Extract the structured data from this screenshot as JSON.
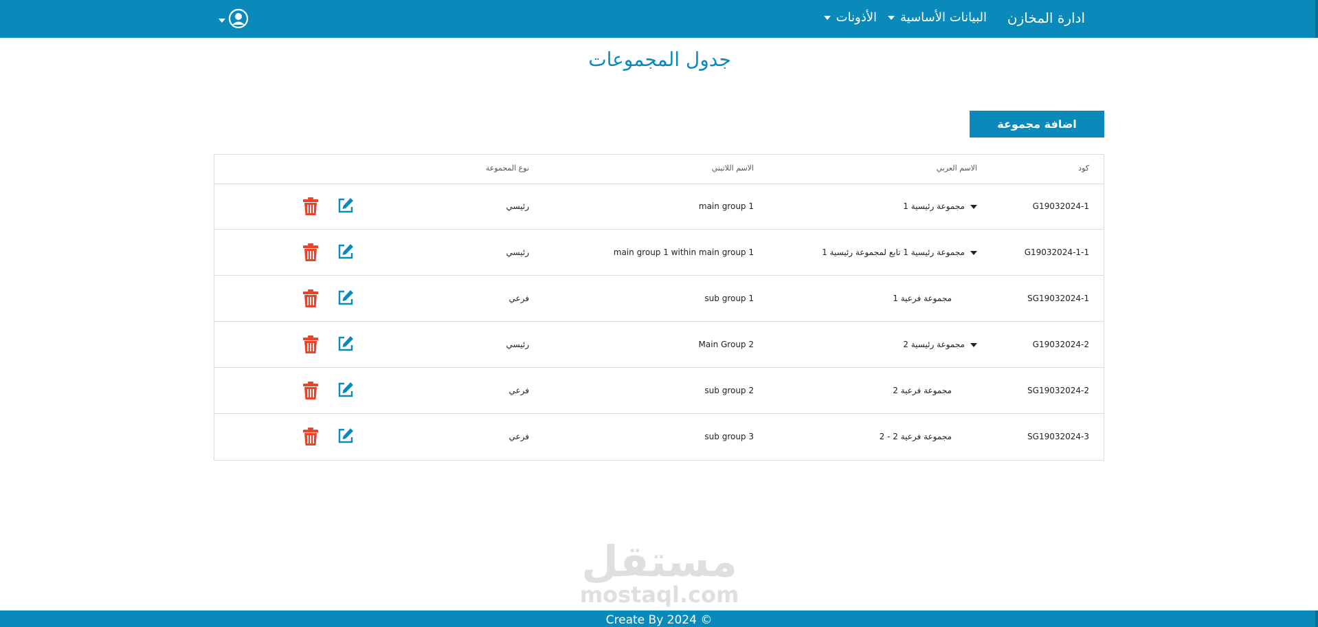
{
  "nav": {
    "brand": "ادارة المخازن",
    "basic_data": "البيانات الأساسية",
    "permissions": "الأذونات"
  },
  "page": {
    "title": "جدول المجموعات",
    "add_button": "اضافة مجموعة"
  },
  "table": {
    "headers": {
      "code": "كود",
      "arabic_name": "الاسم العربي",
      "latin_name": "الاسم اللاتيني",
      "group_type": "نوع المجموعة"
    },
    "rows": [
      {
        "code": "G19032024-1",
        "arabic_name": "مجموعة رئيسية 1",
        "latin_name": "main group 1",
        "group_type": "رئيسي",
        "expandable": true
      },
      {
        "code": "G19032024-1-1",
        "arabic_name": "مجموعة رئيسية 1 تابع لمجموعة رئيسية 1",
        "latin_name": "main group 1 within main group 1",
        "group_type": "رئيسي",
        "expandable": true
      },
      {
        "code": "SG19032024-1",
        "arabic_name": "مجموعة فرعية 1",
        "latin_name": "sub group 1",
        "group_type": "فرعي",
        "expandable": false
      },
      {
        "code": "G19032024-2",
        "arabic_name": "مجموعة رئيسية 2",
        "latin_name": "Main Group 2",
        "group_type": "رئيسي",
        "expandable": true
      },
      {
        "code": "SG19032024-2",
        "arabic_name": "مجموعة فرعية 2",
        "latin_name": "sub group 2",
        "group_type": "فرعي",
        "expandable": false
      },
      {
        "code": "SG19032024-3",
        "arabic_name": "مجموعة فرعية 2 - 2",
        "latin_name": "sub group 3",
        "group_type": "فرعي",
        "expandable": false
      }
    ]
  },
  "watermark": {
    "arabic": "مستقل",
    "latin": "mostaql.com"
  },
  "footer": {
    "text": "Create By 2024 ©"
  },
  "colors": {
    "primary": "#0a8abb",
    "delete": "#e8432b",
    "edit": "#0a8abb"
  },
  "icons": {
    "user": "user-circle-icon",
    "edit": "edit-icon",
    "delete": "trash-icon",
    "expand": "caret-down-icon"
  }
}
